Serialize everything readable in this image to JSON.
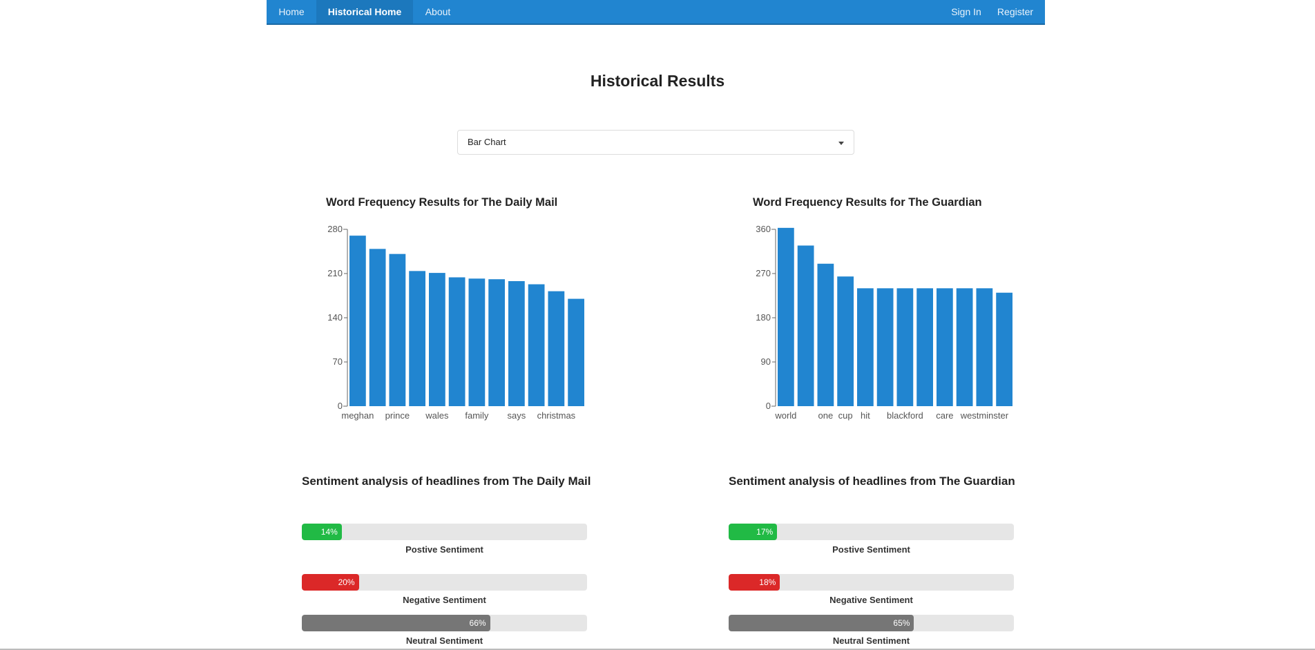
{
  "nav": {
    "home": "Home",
    "historical_home": "Historical Home",
    "about": "About",
    "sign_in": "Sign In",
    "register": "Register"
  },
  "page_title": "Historical Results",
  "chart_select": {
    "selected": "Bar Chart"
  },
  "chart_data": [
    {
      "type": "bar",
      "title": "Word Frequency Results for The Daily Mail",
      "categories": [
        "meghan",
        "",
        "prince",
        "",
        "wales",
        "",
        "family",
        "",
        "says",
        "",
        "christmas",
        ""
      ],
      "values": [
        270,
        249,
        241,
        214,
        211,
        204,
        202,
        201,
        198,
        193,
        182,
        170
      ],
      "ylim": [
        0,
        280
      ],
      "yticks": [
        0,
        70,
        140,
        210,
        280
      ],
      "bar_color": "#2185d0"
    },
    {
      "type": "bar",
      "title": "Word Frequency Results for The Guardian",
      "categories": [
        "world",
        "",
        "one",
        "cup",
        "hit",
        "",
        "blackford",
        "",
        "care",
        "",
        "westminster",
        ""
      ],
      "values": [
        363,
        327,
        290,
        264,
        240,
        240,
        240,
        240,
        240,
        240,
        240,
        231
      ],
      "ylim": [
        0,
        360
      ],
      "yticks": [
        0,
        90,
        180,
        270,
        360
      ],
      "bar_color": "#2185d0"
    }
  ],
  "sentiment": {
    "daily_mail": {
      "title": "Sentiment analysis of headlines from The Daily Mail",
      "positive": {
        "value": 14,
        "text": "14%",
        "label": "Postive Sentiment"
      },
      "negative": {
        "value": 20,
        "text": "20%",
        "label": "Negative Sentiment"
      },
      "neutral": {
        "value": 66,
        "text": "66%",
        "label": "Neutral Sentiment"
      }
    },
    "guardian": {
      "title": "Sentiment analysis of headlines from The Guardian",
      "positive": {
        "value": 17,
        "text": "17%",
        "label": "Postive Sentiment"
      },
      "negative": {
        "value": 18,
        "text": "18%",
        "label": "Negative Sentiment"
      },
      "neutral": {
        "value": 65,
        "text": "65%",
        "label": "Neutral Sentiment"
      }
    }
  },
  "colors": {
    "nav_bg": "#2185d0",
    "positive": "#21ba45",
    "negative": "#db2828",
    "neutral": "#767676"
  }
}
